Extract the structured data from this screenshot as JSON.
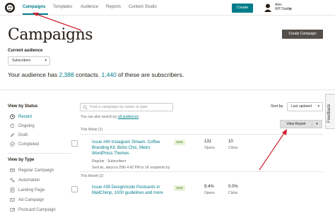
{
  "topnav": {
    "items": [
      {
        "label": "Campaigns",
        "active": true
      },
      {
        "label": "Templates",
        "active": false
      },
      {
        "label": "Audience",
        "active": false
      },
      {
        "label": "Reports",
        "active": false
      },
      {
        "label": "Content Studio",
        "active": false
      }
    ],
    "create_label": "Create",
    "user_name_line1": "Alex",
    "user_name_line2": "WP Daddy"
  },
  "page": {
    "title": "Campaigns",
    "create_campaign_label": "Create Campaign",
    "current_audience_label": "Current audience",
    "audience_select_value": "Subscribers",
    "audience_summary_prefix": "Your audience has ",
    "contacts_count": "2,388",
    "audience_summary_middle": " contacts. ",
    "subscribers_count": "1,440",
    "audience_summary_suffix": " of these are subscribers."
  },
  "sidebar": {
    "status_heading": "View by Status",
    "status_items": [
      {
        "label": "Recent",
        "active": true,
        "icon": "clock-icon"
      },
      {
        "label": "Ongoing",
        "active": false,
        "icon": "refresh-icon"
      },
      {
        "label": "Draft",
        "active": false,
        "icon": "pencil-icon"
      },
      {
        "label": "Completed",
        "active": false,
        "icon": "check-icon"
      }
    ],
    "type_heading": "View by Type",
    "type_items": [
      {
        "label": "Regular Campaign",
        "icon": "envelope-icon"
      },
      {
        "label": "Automation",
        "icon": "automation-icon"
      },
      {
        "label": "Landing Page",
        "icon": "page-icon"
      },
      {
        "label": "Ad Campaign",
        "icon": "ad-icon"
      },
      {
        "label": "Postcard Campaign",
        "icon": "postcard-icon"
      }
    ]
  },
  "list": {
    "search_placeholder": "Find a campaign by name or type",
    "search_hint_prefix": "You can also search by ",
    "search_hint_link": "all audiences",
    "search_hint_suffix": ".",
    "sort_label": "Sort by",
    "sort_value": "Last updated",
    "groups": [
      {
        "label": "This Week (1)",
        "campaigns": [
          {
            "title": "Issue #40 Instagram Stream, Coffee Branding Kit, Boho Chic, Metro WordPress Themes",
            "type": "Regular · Subscribers",
            "sent": "Sent вс, августа 25th 4:42 PM to 1K recipients by",
            "status": "Sent",
            "opens_value": "131",
            "opens_label": "Opens",
            "clicks_value": "10",
            "clicks_label": "Clicks",
            "action_label": "View Report"
          }
        ]
      },
      {
        "label": "This Month (2)",
        "campaigns": [
          {
            "title": "Issue #39 Designmodo Postcards in MailChimp, 1000 guidelines and more",
            "status": "Sent",
            "opens_value": "9.4%",
            "opens_label": "Opens",
            "clicks_value": "0.0%",
            "clicks_label": "Clicks"
          }
        ]
      }
    ]
  },
  "feedback_label": "Feedback",
  "colors": {
    "accent": "#007c89",
    "annotation": "#d0202e",
    "dark_button": "#544e4a",
    "sent_badge_bg": "#e7f4d7"
  }
}
